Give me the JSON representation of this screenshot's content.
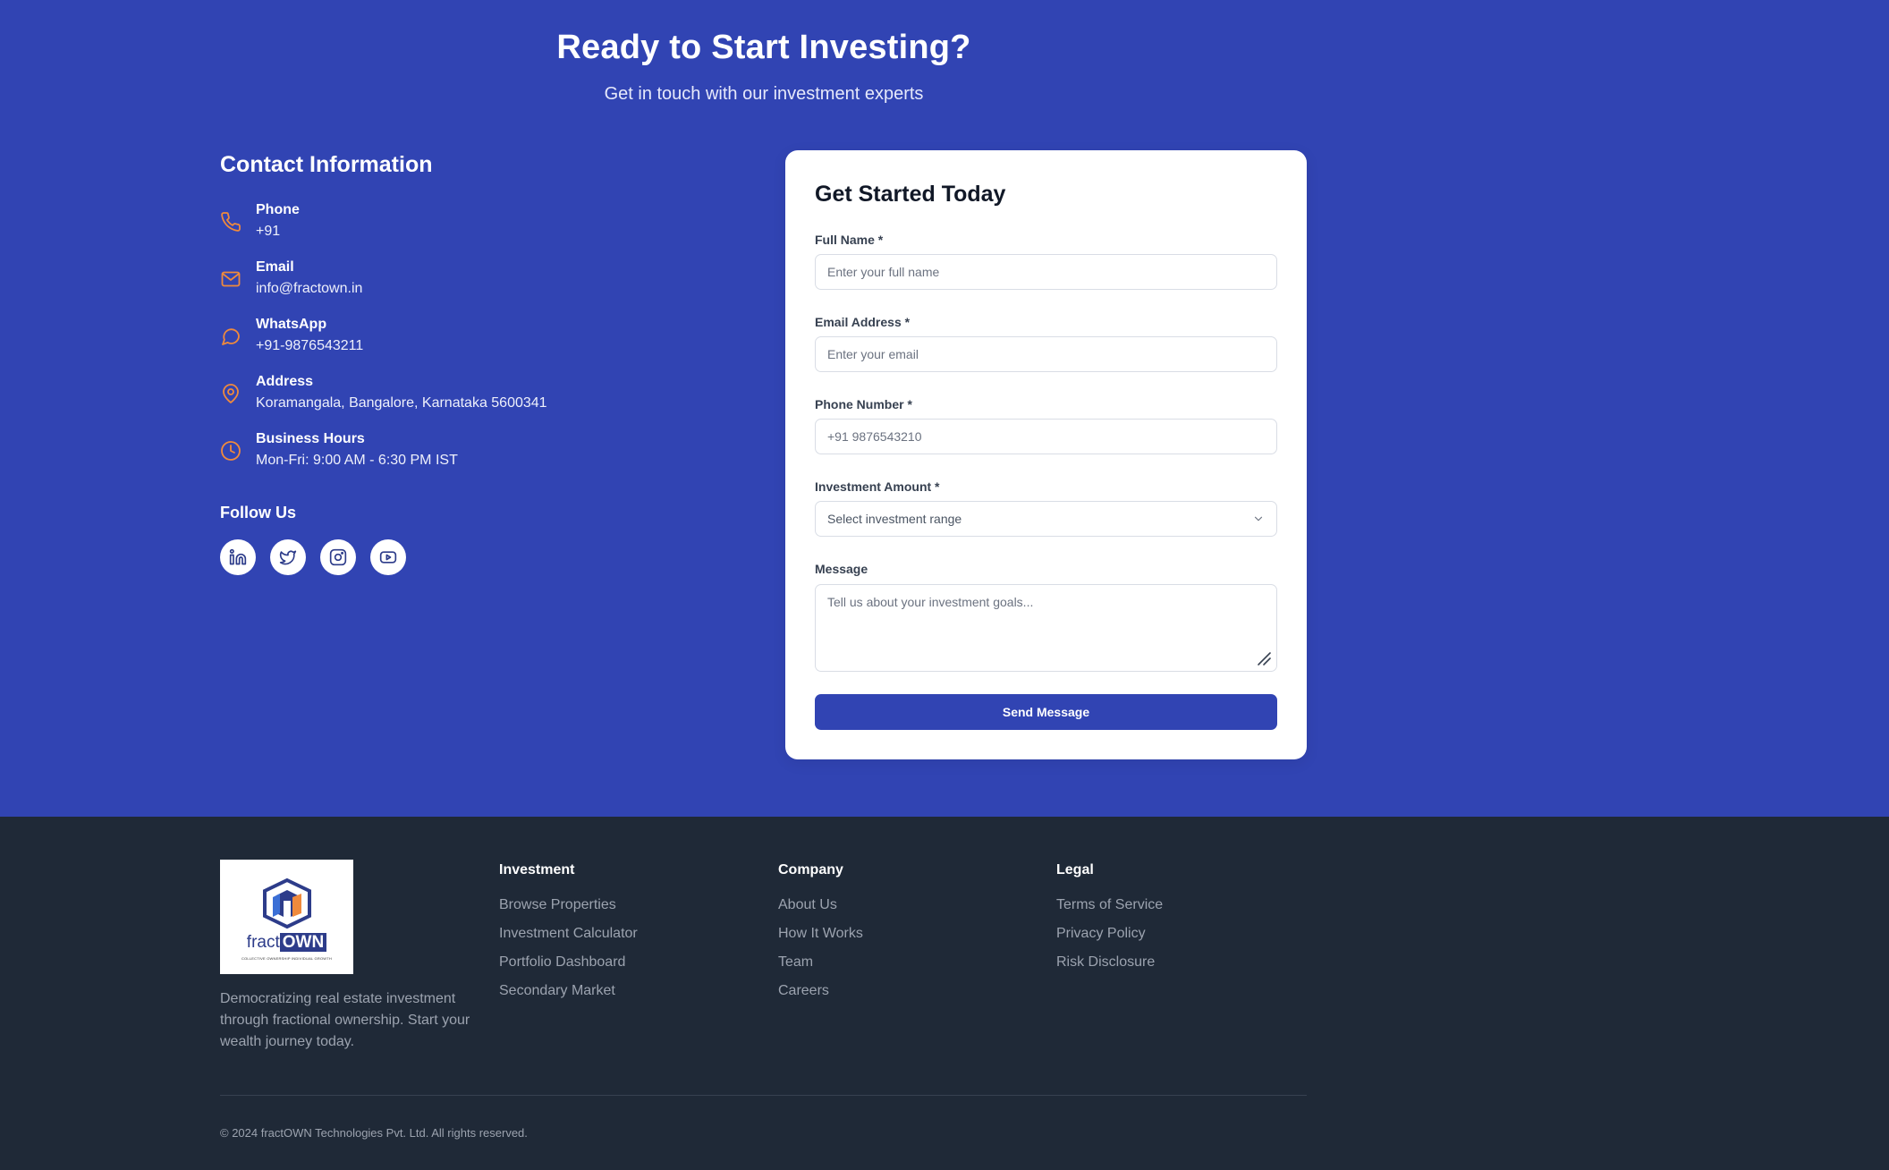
{
  "hero": {
    "title": "Ready to Start Investing?",
    "subtitle": "Get in touch with our investment experts"
  },
  "contact": {
    "title": "Contact Information",
    "items": [
      {
        "icon": "phone-icon",
        "label": "Phone",
        "value": "+91"
      },
      {
        "icon": "mail-icon",
        "label": "Email",
        "value": "info@fractown.in"
      },
      {
        "icon": "chat-icon",
        "label": "WhatsApp",
        "value": "+91-9876543211"
      },
      {
        "icon": "map-pin-icon",
        "label": "Address",
        "value": "Koramangala, Bangalore, Karnataka 5600341"
      },
      {
        "icon": "clock-icon",
        "label": "Business Hours",
        "value": "Mon-Fri: 9:00 AM - 6:30 PM IST"
      }
    ],
    "follow_title": "Follow Us",
    "socials": [
      "linkedin-icon",
      "twitter-icon",
      "instagram-icon",
      "youtube-icon"
    ]
  },
  "form": {
    "title": "Get Started Today",
    "full_name": {
      "label": "Full Name *",
      "placeholder": "Enter your full name",
      "value": ""
    },
    "email": {
      "label": "Email Address *",
      "placeholder": "Enter your email",
      "value": ""
    },
    "phone": {
      "label": "Phone Number *",
      "placeholder": "+91 9876543210",
      "value": ""
    },
    "amount": {
      "label": "Investment Amount *",
      "selected": "Select investment range"
    },
    "message": {
      "label": "Message",
      "placeholder": "Tell us about your investment goals...",
      "value": ""
    },
    "submit_label": "Send Message"
  },
  "footer": {
    "logo": {
      "text_part1": "fract",
      "text_part2": "OWN",
      "tagline": "COLLECTIVE OWNERSHIP INDIVIDUAL GROWTH"
    },
    "description": "Democratizing real estate investment through fractional ownership. Start your wealth journey today.",
    "columns": [
      {
        "title": "Investment",
        "links": [
          "Browse Properties",
          "Investment Calculator",
          "Portfolio Dashboard",
          "Secondary Market"
        ]
      },
      {
        "title": "Company",
        "links": [
          "About Us",
          "How It Works",
          "Team",
          "Careers"
        ]
      },
      {
        "title": "Legal",
        "links": [
          "Terms of Service",
          "Privacy Policy",
          "Risk Disclosure"
        ]
      }
    ],
    "copyright": "© 2024 fractOWN Technologies Pvt. Ltd. All rights reserved."
  },
  "colors": {
    "hero_bg": "#3144b3",
    "accent_orange": "#f08a3c",
    "footer_bg": "#1f2937",
    "button_bg": "#3144b3"
  }
}
